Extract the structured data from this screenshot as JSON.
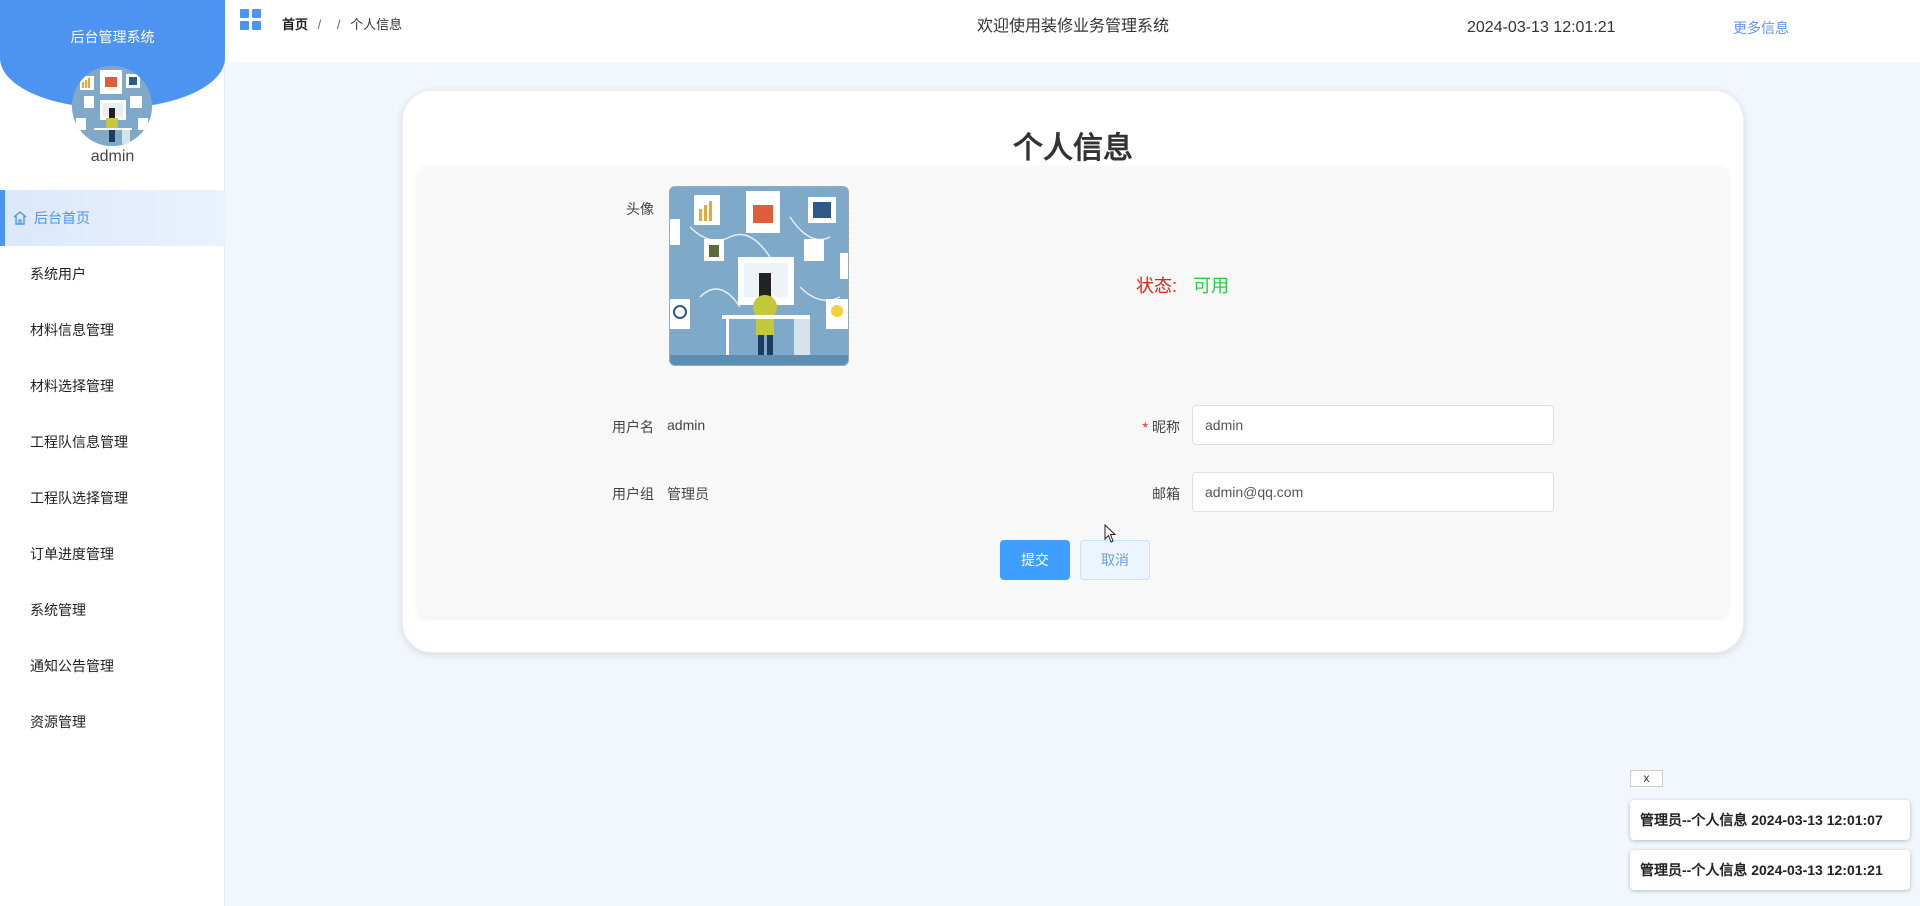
{
  "sidebar": {
    "app_title": "后台管理系统",
    "username": "admin",
    "items": [
      {
        "label": "后台首页",
        "icon": "home-icon",
        "active": true
      },
      {
        "label": "系统用户"
      },
      {
        "label": "材料信息管理"
      },
      {
        "label": "材料选择管理"
      },
      {
        "label": "工程队信息管理"
      },
      {
        "label": "工程队选择管理"
      },
      {
        "label": "订单进度管理"
      },
      {
        "label": "系统管理"
      },
      {
        "label": "通知公告管理"
      },
      {
        "label": "资源管理"
      }
    ]
  },
  "header": {
    "breadcrumb_home": "首页",
    "breadcrumb_sep1": "/",
    "breadcrumb_sep2": "/",
    "breadcrumb_current": "个人信息",
    "welcome": "欢迎使用装修业务管理系统",
    "datetime": "2024-03-13 12:01:21",
    "more_info": "更多信息"
  },
  "profile": {
    "title": "个人信息",
    "avatar_label": "头像",
    "status_label": "状态:",
    "status_value": "可用",
    "username_label": "用户名",
    "username_value": "admin",
    "group_label": "用户组",
    "group_value": "管理员",
    "nickname_required": "*",
    "nickname_label": "昵称",
    "nickname_value": "admin",
    "email_label": "邮箱",
    "email_value": "admin@qq.com",
    "submit_label": "提交",
    "cancel_label": "取消"
  },
  "notifications": {
    "close_label": "x",
    "items": [
      {
        "text": "管理员--个人信息 2024-03-13 12:01:07"
      },
      {
        "text": "管理员--个人信息 2024-03-13 12:01:21"
      }
    ]
  },
  "colors": {
    "accent": "#4d93f2",
    "status_label": "#e2231a",
    "status_value": "#2ecc40",
    "submit": "#409eff"
  }
}
